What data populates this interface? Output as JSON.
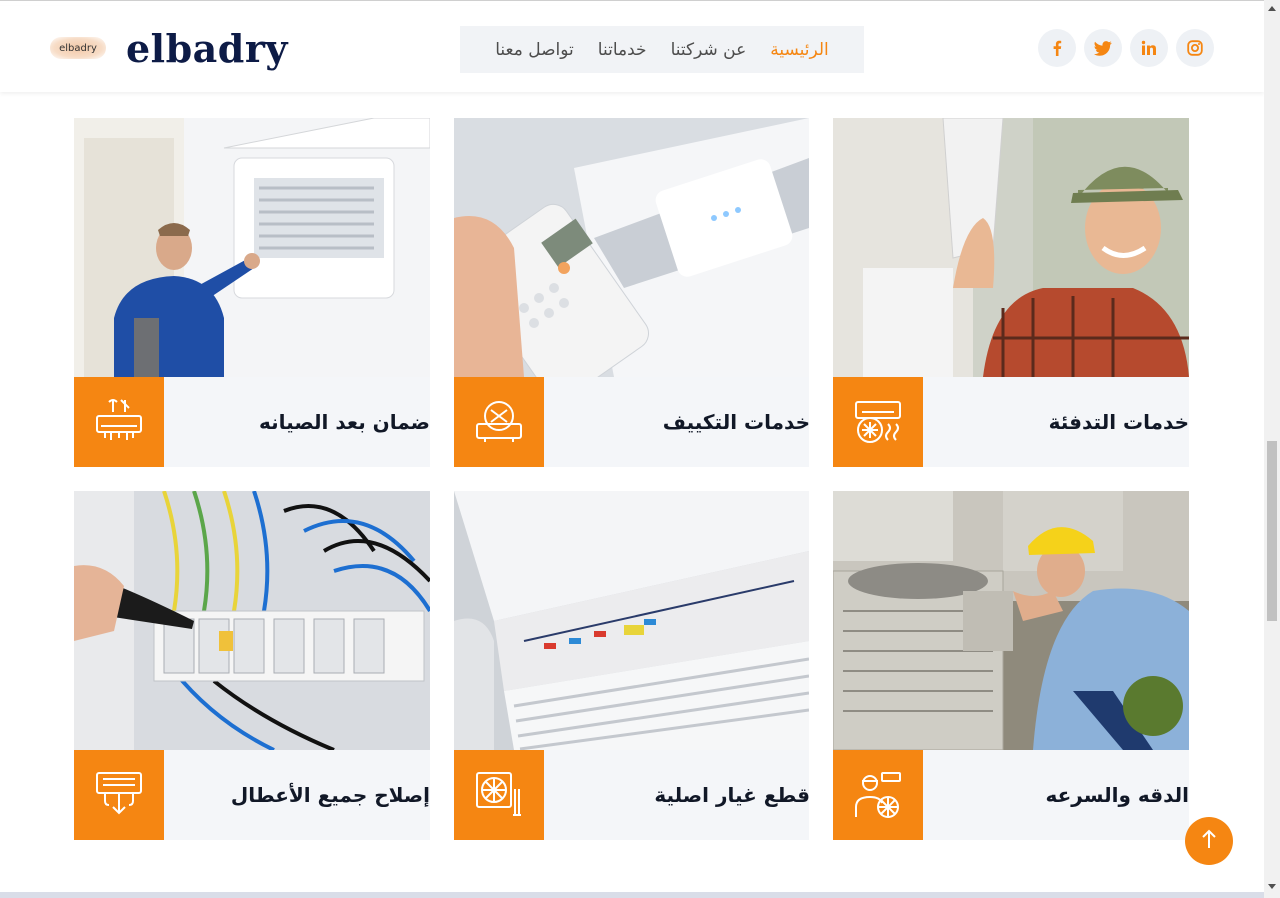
{
  "header": {
    "logo_badge": "elbadry",
    "logo_text": "elbadry"
  },
  "nav": {
    "items": [
      {
        "label": "الرئيسية",
        "active": true
      },
      {
        "label": "عن شركتنا",
        "active": false
      },
      {
        "label": "خدماتنا",
        "active": false
      },
      {
        "label": "تواصل معنا",
        "active": false
      }
    ]
  },
  "social": {
    "items": [
      {
        "icon": "instagram-icon",
        "glyph": "◎"
      },
      {
        "icon": "linkedin-icon",
        "glyph": "in"
      },
      {
        "icon": "twitter-icon",
        "glyph": "🐦"
      },
      {
        "icon": "facebook-icon",
        "glyph": "f"
      }
    ]
  },
  "colors": {
    "accent": "#f58612",
    "navy": "#0d1b46",
    "card_bg": "#f4f6f9"
  },
  "services": [
    {
      "title": "ضمان بعد الصيانه",
      "icon": "ac-tools-icon",
      "photo": "technician-ac-photo"
    },
    {
      "title": "خدمات التكييف",
      "icon": "ac-repair-icon",
      "photo": "remote-control-photo"
    },
    {
      "title": "خدمات التدفئة",
      "icon": "ac-fan-icon",
      "photo": "smiling-technician-photo"
    },
    {
      "title": "إصلاح جميع الأعطال",
      "icon": "ac-vent-icon",
      "photo": "electrical-panel-photo"
    },
    {
      "title": "قطع غيار اصلية",
      "icon": "fan-tools-icon",
      "photo": "ac-unit-closeup-photo"
    },
    {
      "title": "الدقه والسرعه",
      "icon": "worker-fan-icon",
      "photo": "outdoor-unit-repair-photo"
    }
  ],
  "scroll_top": {
    "icon": "arrow-up-icon"
  }
}
